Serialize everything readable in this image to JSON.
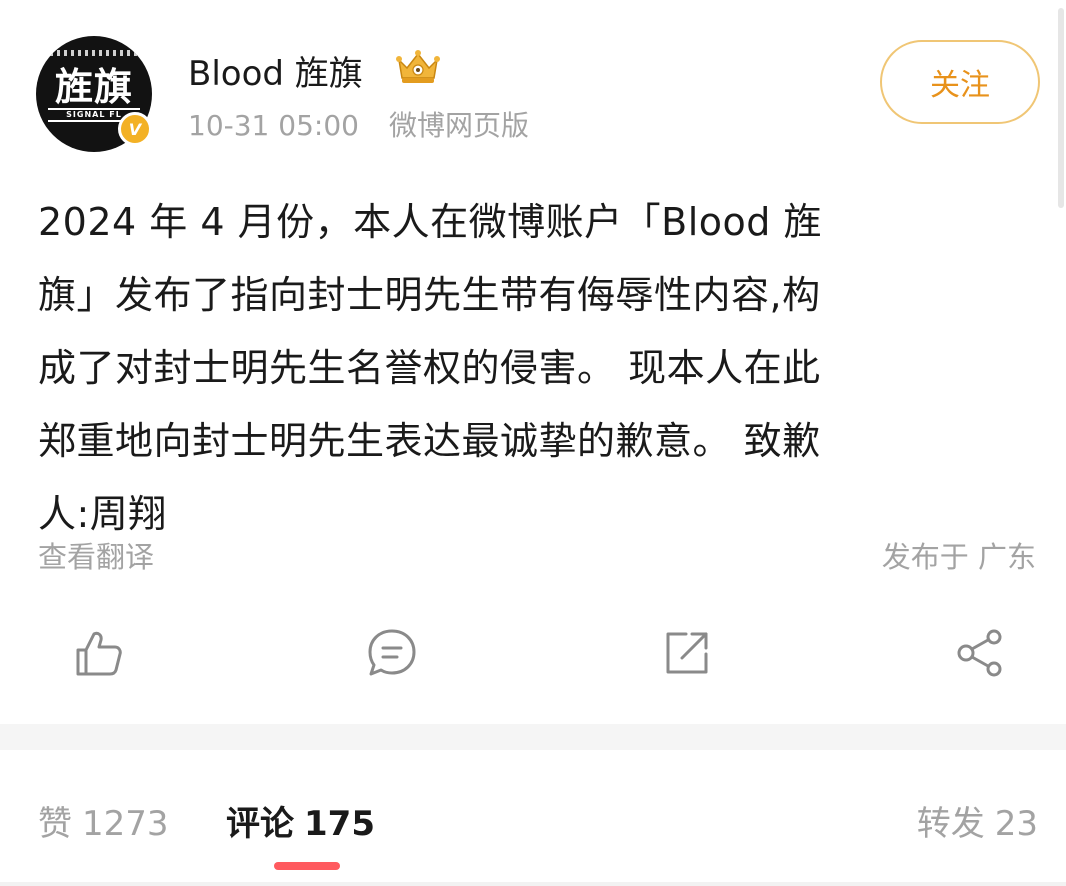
{
  "post": {
    "author": {
      "name": "Blood 旌旗",
      "avatar_text": "旌旗",
      "avatar_band_text": "SIGNAL FL",
      "verified_badge": "V"
    },
    "time": "10-31 05:00",
    "source": "微博网页版",
    "follow_label": "关注",
    "content": "2024 年 4 月份，本人在微博账户「Blood 旌\n旗」发布了指向封士明先生带有侮辱性内容,构\n成了对封士明先生名誉权的侵害。 现本人在此\n郑重地向封士明先生表达最诚挚的歉意。 致歉\n人:周翔",
    "translate_label": "查看翻译",
    "location": "发布于 广东"
  },
  "actions": {
    "like_icon": "thumbs-up-icon",
    "comment_icon": "comment-bubble-icon",
    "repost_icon": "repost-arrow-icon",
    "share_icon": "share-icon"
  },
  "tabs": {
    "like": {
      "label": "赞",
      "count": "1273"
    },
    "comment": {
      "label": "评论",
      "count": "175"
    },
    "repost": {
      "label": "转发",
      "count": "23"
    }
  },
  "colors": {
    "accent": "#e8921b",
    "follow_border": "#f0c675",
    "muted_text": "#a3a3a3",
    "active_underline": "#ff5a5f",
    "verified": "#f3b125"
  }
}
